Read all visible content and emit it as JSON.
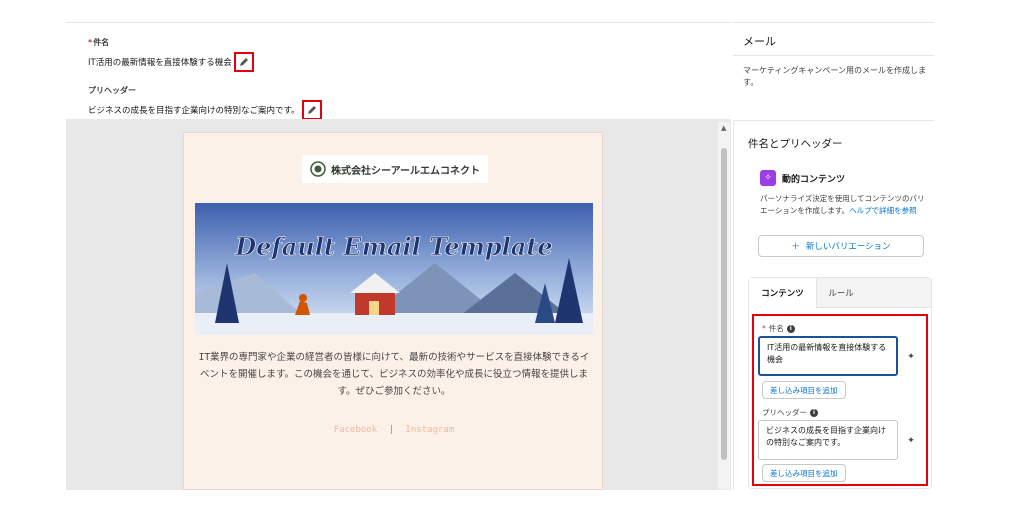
{
  "subject": {
    "label": "件名",
    "value": "IT活用の最新情報を直接体験する機会"
  },
  "preheader": {
    "label": "プリヘッダー",
    "value": "ビジネスの成長を目指す企業向けの特別なご案内です。"
  },
  "email_preview": {
    "logo_text": "株式会社シーアールエムコネクト",
    "banner_title": "Default Email Template",
    "body_text": "IT業界の専門家や企業の経営者の皆様に向けて、最新の技術やサービスを直接体験できるイベントを開催します。この機会を通じて、ビジネスの効率化や成長に役立つ情報を提供します。ぜひご参加ください。",
    "social_links": [
      "Facebook",
      "Instagram"
    ],
    "social_separator": "|"
  },
  "email_panel": {
    "title": "メール",
    "description": "マーケティングキャンペーン用のメールを作成します。"
  },
  "properties_panel": {
    "title": "件名とプリヘッダー",
    "dynamic_content": {
      "title": "動的コンテンツ",
      "description": "パーソナライズ決定を使用してコンテンツのバリエーションを作成します。",
      "help_link": "ヘルプで詳細を参照",
      "new_variation_button": "新しいバリエーション"
    },
    "tabs": [
      "コンテンツ",
      "ルール"
    ],
    "subject_field": {
      "label": "件名",
      "value": "IT活用の最新情報を直接体験する機会",
      "merge_button": "差し込み項目を追加"
    },
    "preheader_field": {
      "label": "プリヘッダー",
      "value": "ビジネスの成長を目指す企業向けの特別なご案内です。",
      "merge_button": "差し込み項目を追加"
    }
  },
  "colors": {
    "highlight": "#e3000f",
    "link": "#0176d3",
    "dynamic_icon": "#9b3fe5",
    "email_background": "#fcf1e8"
  },
  "icons": [
    "pencil-icon",
    "plus-icon",
    "info-icon",
    "sparkle-icon",
    "dynamic-content-icon",
    "scroll-up-icon"
  ]
}
